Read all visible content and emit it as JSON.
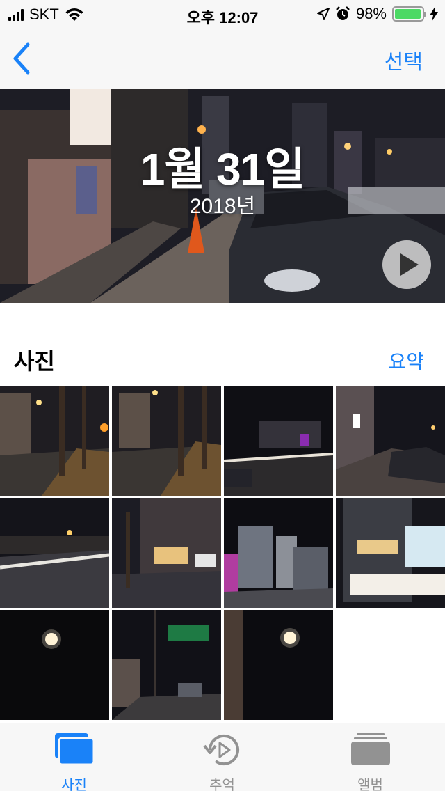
{
  "status_bar": {
    "carrier": "SKT",
    "time": "오후 12:07",
    "battery_percent": "98%",
    "battery_level": 0.98,
    "icons": [
      "signal-icon",
      "wifi-icon",
      "location-arrow-icon",
      "alarm-icon",
      "battery-icon",
      "charging-bolt-icon"
    ]
  },
  "nav": {
    "back_icon": "chevron-left-icon",
    "select_label": "선택"
  },
  "hero": {
    "date": "1월 31일",
    "year": "2018년",
    "play_icon": "play-icon"
  },
  "section": {
    "title": "사진",
    "summary_label": "요약"
  },
  "photos": [
    "night-street-trees",
    "night-street-trees",
    "night-street-light-trails",
    "night-street-parked-car",
    "night-road-river",
    "night-street-shops",
    "night-city-buildings",
    "night-building-corner",
    "full-moon",
    "night-road-signs",
    "full-moon-wall"
  ],
  "tab_bar": {
    "tabs": [
      {
        "label": "사진",
        "icon": "photos-stack-icon",
        "active": true
      },
      {
        "label": "추억",
        "icon": "memories-play-icon",
        "active": false
      },
      {
        "label": "앨범",
        "icon": "albums-icon",
        "active": false
      }
    ],
    "accent_color": "#1a82f8",
    "inactive_color": "#929292"
  },
  "colors": {
    "accent": "#1a82f8",
    "battery": "#4cd964"
  }
}
